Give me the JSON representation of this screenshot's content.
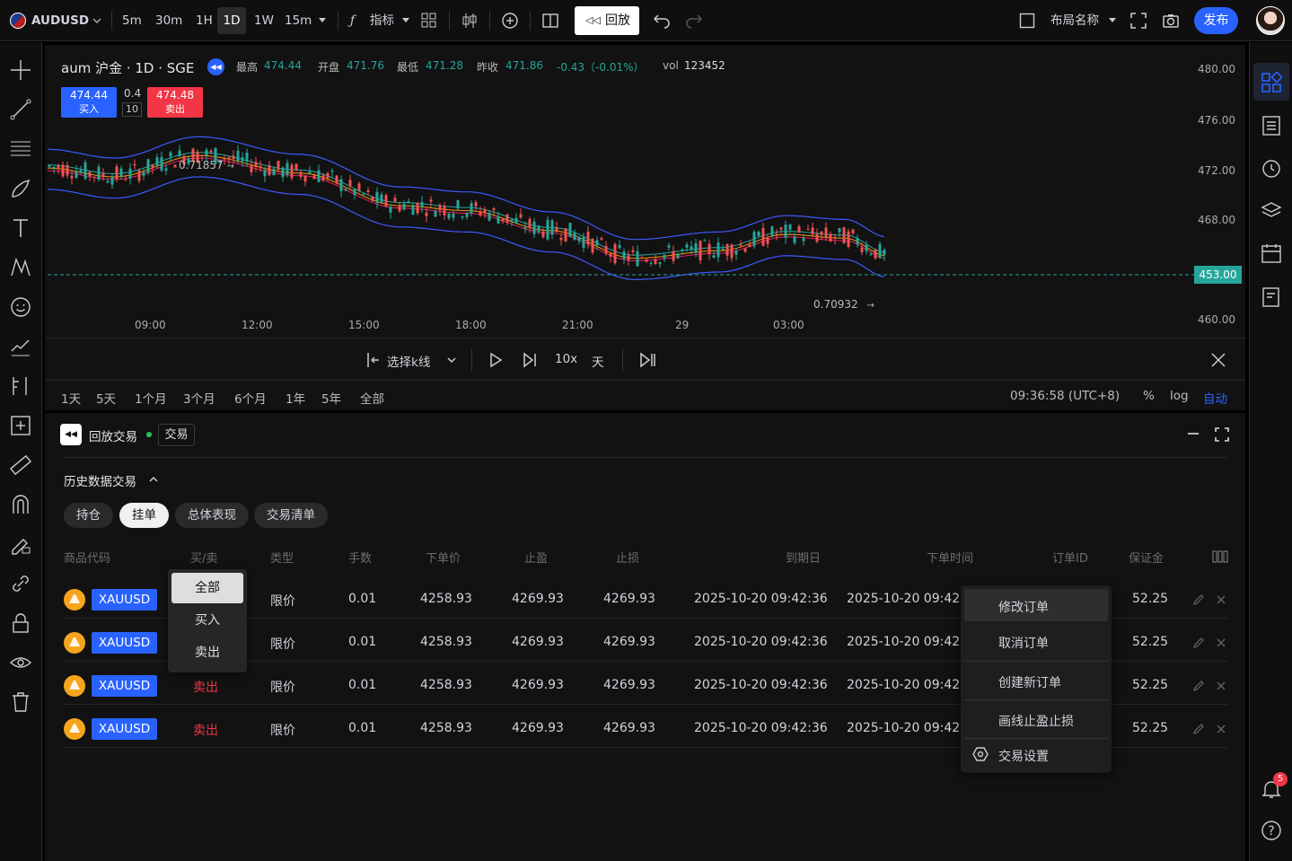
{
  "topbar": {
    "symbol": "AUDUSD",
    "intervals": [
      "5m",
      "30m",
      "1H",
      "1D",
      "1W",
      "15m"
    ],
    "active_interval": "1D",
    "indicators_label": "指标",
    "replay_label": "回放",
    "layout_name": "布局名称",
    "publish_label": "发布"
  },
  "chart": {
    "title": "aum 沪金 · 1D · SGE",
    "stats": [
      {
        "label": "最高",
        "value": "474.44"
      },
      {
        "label": "开盘",
        "value": "471.76"
      },
      {
        "label": "最低",
        "value": "471.28"
      },
      {
        "label": "昨收",
        "value": "471.86"
      }
    ],
    "change": "-0.43（-0.01%）",
    "vol_label": "vol",
    "vol_value": "123452",
    "buy_price": "474.44",
    "buy_label": "买入",
    "spread": "0.4",
    "qty": "10",
    "sell_price": "474.48",
    "sell_label": "卖出",
    "hi_mark": "0.71857",
    "lo_mark": "0.70932",
    "current_price": "453.00",
    "y_ticks": [
      "480.00",
      "476.00",
      "472.00",
      "468.00",
      "460.00"
    ],
    "x_ticks": [
      "09:00",
      "12:00",
      "15:00",
      "18:00",
      "21:00",
      "29",
      "03:00"
    ],
    "colors": {
      "up": "#26a69a",
      "down": "#ef5350",
      "band": "#3d5afe",
      "price_tag": "#26a69a"
    }
  },
  "replay_bar": {
    "select_label": "选择k线",
    "speed": "10x",
    "unit": "天"
  },
  "range_bar": {
    "ranges": [
      "1天",
      "5天",
      "1个月",
      "3个月",
      "6个月",
      "1年",
      "5年",
      "全部"
    ],
    "time": "09:36:58 (UTC+8)",
    "percent": "%",
    "log": "log",
    "auto": "自动"
  },
  "panel": {
    "title": "回放交易",
    "tag": "交易",
    "section": "历史数据交易",
    "tabs": [
      "持仓",
      "挂单",
      "总体表现",
      "交易清单"
    ],
    "active_tab": "挂单",
    "headers": [
      "商品代码",
      "买/卖",
      "类型",
      "手数",
      "下单价",
      "止盈",
      "止损",
      "到期日",
      "下单时间",
      "订单ID",
      "保证金"
    ],
    "rows": [
      {
        "symbol": "XAUUSD",
        "side": "",
        "type": "限价",
        "lots": "0.01",
        "price": "4258.93",
        "tp": "4269.93",
        "sl": "4269.93",
        "expiry": "2025-10-20 09:42:36",
        "time": "2025-10-20 09:42:",
        "margin": "52.25"
      },
      {
        "symbol": "XAUUSD",
        "side": "",
        "type": "限价",
        "lots": "0.01",
        "price": "4258.93",
        "tp": "4269.93",
        "sl": "4269.93",
        "expiry": "2025-10-20 09:42:36",
        "time": "2025-10-20 09:42:",
        "margin": "52.25"
      },
      {
        "symbol": "XAUUSD",
        "side": "卖出",
        "type": "限价",
        "lots": "0.01",
        "price": "4258.93",
        "tp": "4269.93",
        "sl": "4269.93",
        "expiry": "2025-10-20 09:42:36",
        "time": "2025-10-20 09:42:",
        "margin": "52.25"
      },
      {
        "symbol": "XAUUSD",
        "side": "卖出",
        "type": "限价",
        "lots": "0.01",
        "price": "4258.93",
        "tp": "4269.93",
        "sl": "4269.93",
        "expiry": "2025-10-20 09:42:36",
        "time": "2025-10-20 09:42:",
        "margin": "52.25"
      }
    ],
    "side_filter": {
      "options": [
        "全部",
        "买入",
        "卖出"
      ],
      "selected": "全部"
    },
    "context_menu": [
      "修改订单",
      "取消订单",
      "创建新订单",
      "画线止盈止损",
      "交易设置"
    ]
  },
  "notifications": {
    "count": "5"
  }
}
